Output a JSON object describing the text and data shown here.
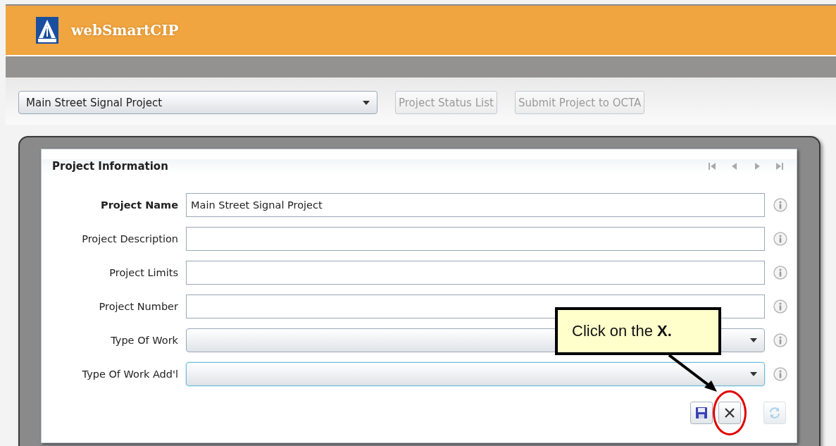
{
  "app": {
    "title": "webSmartCIP"
  },
  "toolbar": {
    "project_selector": {
      "value": "Main Street Signal Project"
    },
    "buttons": [
      {
        "label": "Project Status List",
        "disabled": true
      },
      {
        "label": "Submit Project to OCTA",
        "disabled": true
      }
    ]
  },
  "panel": {
    "title": "Project Information",
    "fields": [
      {
        "label": "Project Name",
        "kind": "text",
        "value": "Main Street Signal Project",
        "emphasized": true,
        "focused": false
      },
      {
        "label": "Project Description",
        "kind": "text",
        "emphasized": false,
        "focused": false
      },
      {
        "label": "Project Limits",
        "kind": "text",
        "emphasized": false,
        "focused": false
      },
      {
        "label": "Project Number",
        "kind": "text",
        "emphasized": false,
        "focused": false
      },
      {
        "label": "Type Of Work",
        "kind": "select",
        "emphasized": false,
        "focused": false
      },
      {
        "label": "Type Of Work Add'l",
        "kind": "select",
        "emphasized": false,
        "focused": true
      }
    ],
    "actions": [
      {
        "kind": "save",
        "disabled": false,
        "highlighted": false
      },
      {
        "kind": "cancel",
        "disabled": false,
        "highlighted": true
      },
      {
        "kind": "refresh",
        "disabled": true,
        "highlighted": false
      }
    ]
  },
  "callout": {
    "text": "Click on the **X.**"
  }
}
